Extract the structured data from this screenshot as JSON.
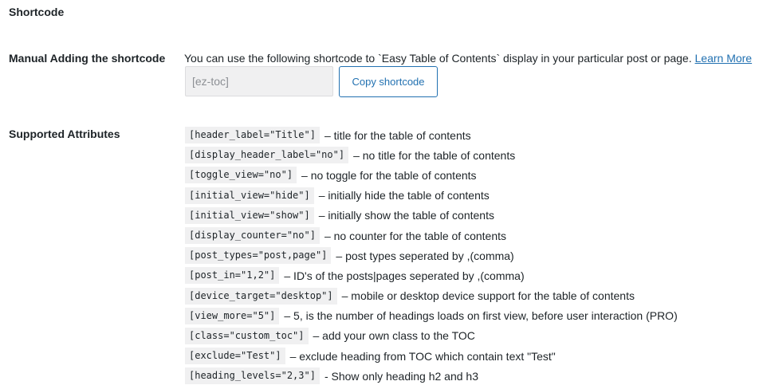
{
  "section_title": "Shortcode",
  "manual": {
    "label": "Manual Adding the shortcode",
    "description": "You can use the following shortcode to `Easy Table of Contents` display in your particular post or page.",
    "learn_more": "Learn More",
    "shortcode_value": "[ez-toc]",
    "copy_button": "Copy shortcode"
  },
  "supported": {
    "label": "Supported Attributes",
    "attributes": [
      {
        "code": "[header_label=\"Title\"]",
        "desc": "– title for the table of contents"
      },
      {
        "code": "[display_header_label=\"no\"]",
        "desc": "– no title for the table of contents"
      },
      {
        "code": "[toggle_view=\"no\"]",
        "desc": "– no toggle for the table of contents"
      },
      {
        "code": "[initial_view=\"hide\"]",
        "desc": "– initially hide the table of contents"
      },
      {
        "code": "[initial_view=\"show\"]",
        "desc": "– initially show the table of contents"
      },
      {
        "code": "[display_counter=\"no\"]",
        "desc": "– no counter for the table of contents"
      },
      {
        "code": "[post_types=\"post,page\"]",
        "desc": "– post types seperated by ,(comma)"
      },
      {
        "code": "[post_in=\"1,2\"]",
        "desc": "– ID's of the posts|pages seperated by ,(comma)"
      },
      {
        "code": "[device_target=\"desktop\"]",
        "desc": "– mobile or desktop device support for the table of contents"
      },
      {
        "code": "[view_more=\"5\"]",
        "desc": "– 5, is the number of headings loads on first view, before user interaction (PRO)"
      },
      {
        "code": "[class=\"custom_toc\"]",
        "desc": "– add your own class to the TOC"
      },
      {
        "code": "[exclude=\"Test\"]",
        "desc": "– exclude heading from TOC which contain text \"Test\""
      },
      {
        "code": "[heading_levels=\"2,3\"]",
        "desc": "- Show only heading h2 and h3"
      }
    ]
  }
}
